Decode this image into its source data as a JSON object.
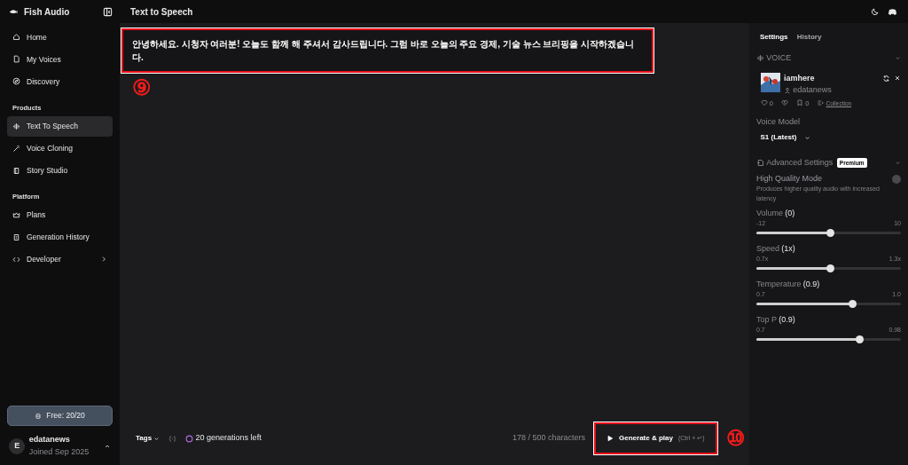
{
  "app": {
    "name": "Fish Audio"
  },
  "header": {
    "title": "Text to Speech"
  },
  "sidebar": {
    "groups": [
      {
        "items": [
          {
            "label": "Home",
            "selected": false
          },
          {
            "label": "My Voices",
            "selected": false
          },
          {
            "label": "Discovery",
            "selected": false
          }
        ]
      },
      {
        "heading": "Products",
        "items": [
          {
            "label": "Text To Speech",
            "selected": true
          },
          {
            "label": "Voice Cloning",
            "selected": false
          },
          {
            "label": "Story Studio",
            "selected": false
          }
        ]
      },
      {
        "heading": "Platform",
        "items": [
          {
            "label": "Plans",
            "selected": false
          },
          {
            "label": "Generation History",
            "selected": false
          },
          {
            "label": "Developer",
            "selected": false,
            "submenu": true
          }
        ]
      }
    ],
    "plan_button": "Free: 20/20",
    "user": {
      "initial": "E",
      "name": "edatanews",
      "joined": "Joined Sep 2025"
    }
  },
  "editor": {
    "text": "안녕하세요. 시청자 여러분! 오늘도 함께 해 주셔서 감사드립니다. 그럼 바로 오늘의 주요 경제, 기술 뉴스 브리핑을 시작하겠습니다.",
    "annotation": "⑨"
  },
  "footer": {
    "tags": "Tags",
    "generations": "20 generations left",
    "characters": "178 / 500 characters",
    "generate_button": "Generate & play",
    "shortcut": "(Ctrl + ↵)",
    "annotation": "⑩"
  },
  "panel": {
    "tabs": [
      {
        "label": "Settings",
        "selected": true
      },
      {
        "label": "History",
        "selected": false
      }
    ],
    "voice_section": {
      "title": "VOICE",
      "expanded": true
    },
    "voice": {
      "name": "iamhere",
      "author": "edatanews",
      "likes": "0",
      "saves": "0",
      "collection": "Collection"
    },
    "model": {
      "label": "Voice Model",
      "value": "S1 (Latest)"
    },
    "advanced": {
      "title": "Advanced Settings",
      "badge": "Premium",
      "expanded": true
    },
    "quality": {
      "label": "High Quality Mode",
      "description": "Produces higher quality audio with increased latency",
      "on": false
    },
    "sliders": [
      {
        "label": "Volume",
        "reading": "(0)",
        "min": "-12",
        "max": "10",
        "level": 0.51
      },
      {
        "label": "Speed",
        "reading": "(1x)",
        "min": "0.7x",
        "max": "1.3x",
        "level": 0.51
      },
      {
        "label": "Temperature",
        "reading": "(0.9)",
        "min": "0.7",
        "max": "1.0",
        "level": 0.66
      },
      {
        "label": "Top P",
        "reading": "(0.9)",
        "min": "0.7",
        "max": "0.98",
        "level": 0.71
      }
    ]
  }
}
